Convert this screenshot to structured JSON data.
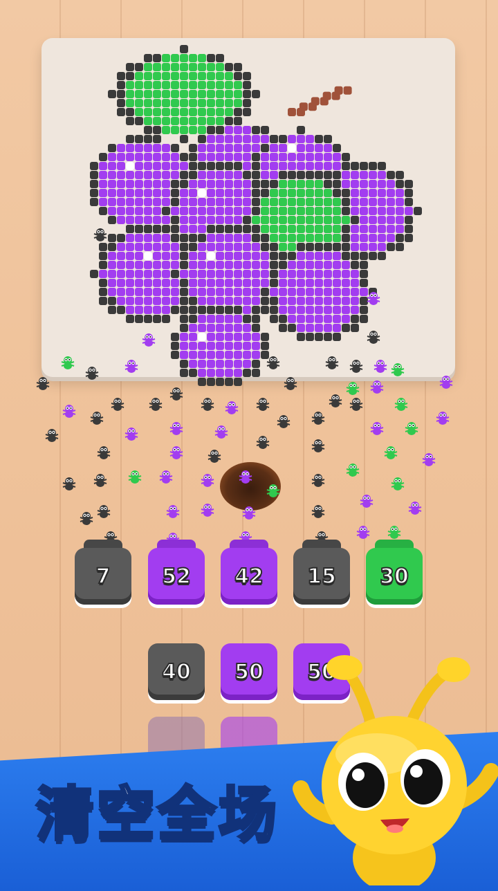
{
  "puzzle": {
    "subject_icon": "grapes-icon"
  },
  "slots": [
    {
      "value": "7",
      "color": "black"
    },
    {
      "value": "52",
      "color": "purple"
    },
    {
      "value": "42",
      "color": "purple"
    },
    {
      "value": "15",
      "color": "black"
    },
    {
      "value": "30",
      "color": "green"
    }
  ],
  "queue_row1": [
    {
      "value": "40",
      "color": "black"
    },
    {
      "value": "50",
      "color": "purple"
    },
    {
      "value": "50",
      "color": "purple"
    }
  ],
  "banner": {
    "text": "清空全场"
  },
  "colors": {
    "purple": "#a23df0",
    "green": "#30c94e",
    "black": "#3a3a3a",
    "stem": "#a0523a",
    "banner": "#1f66dc"
  }
}
